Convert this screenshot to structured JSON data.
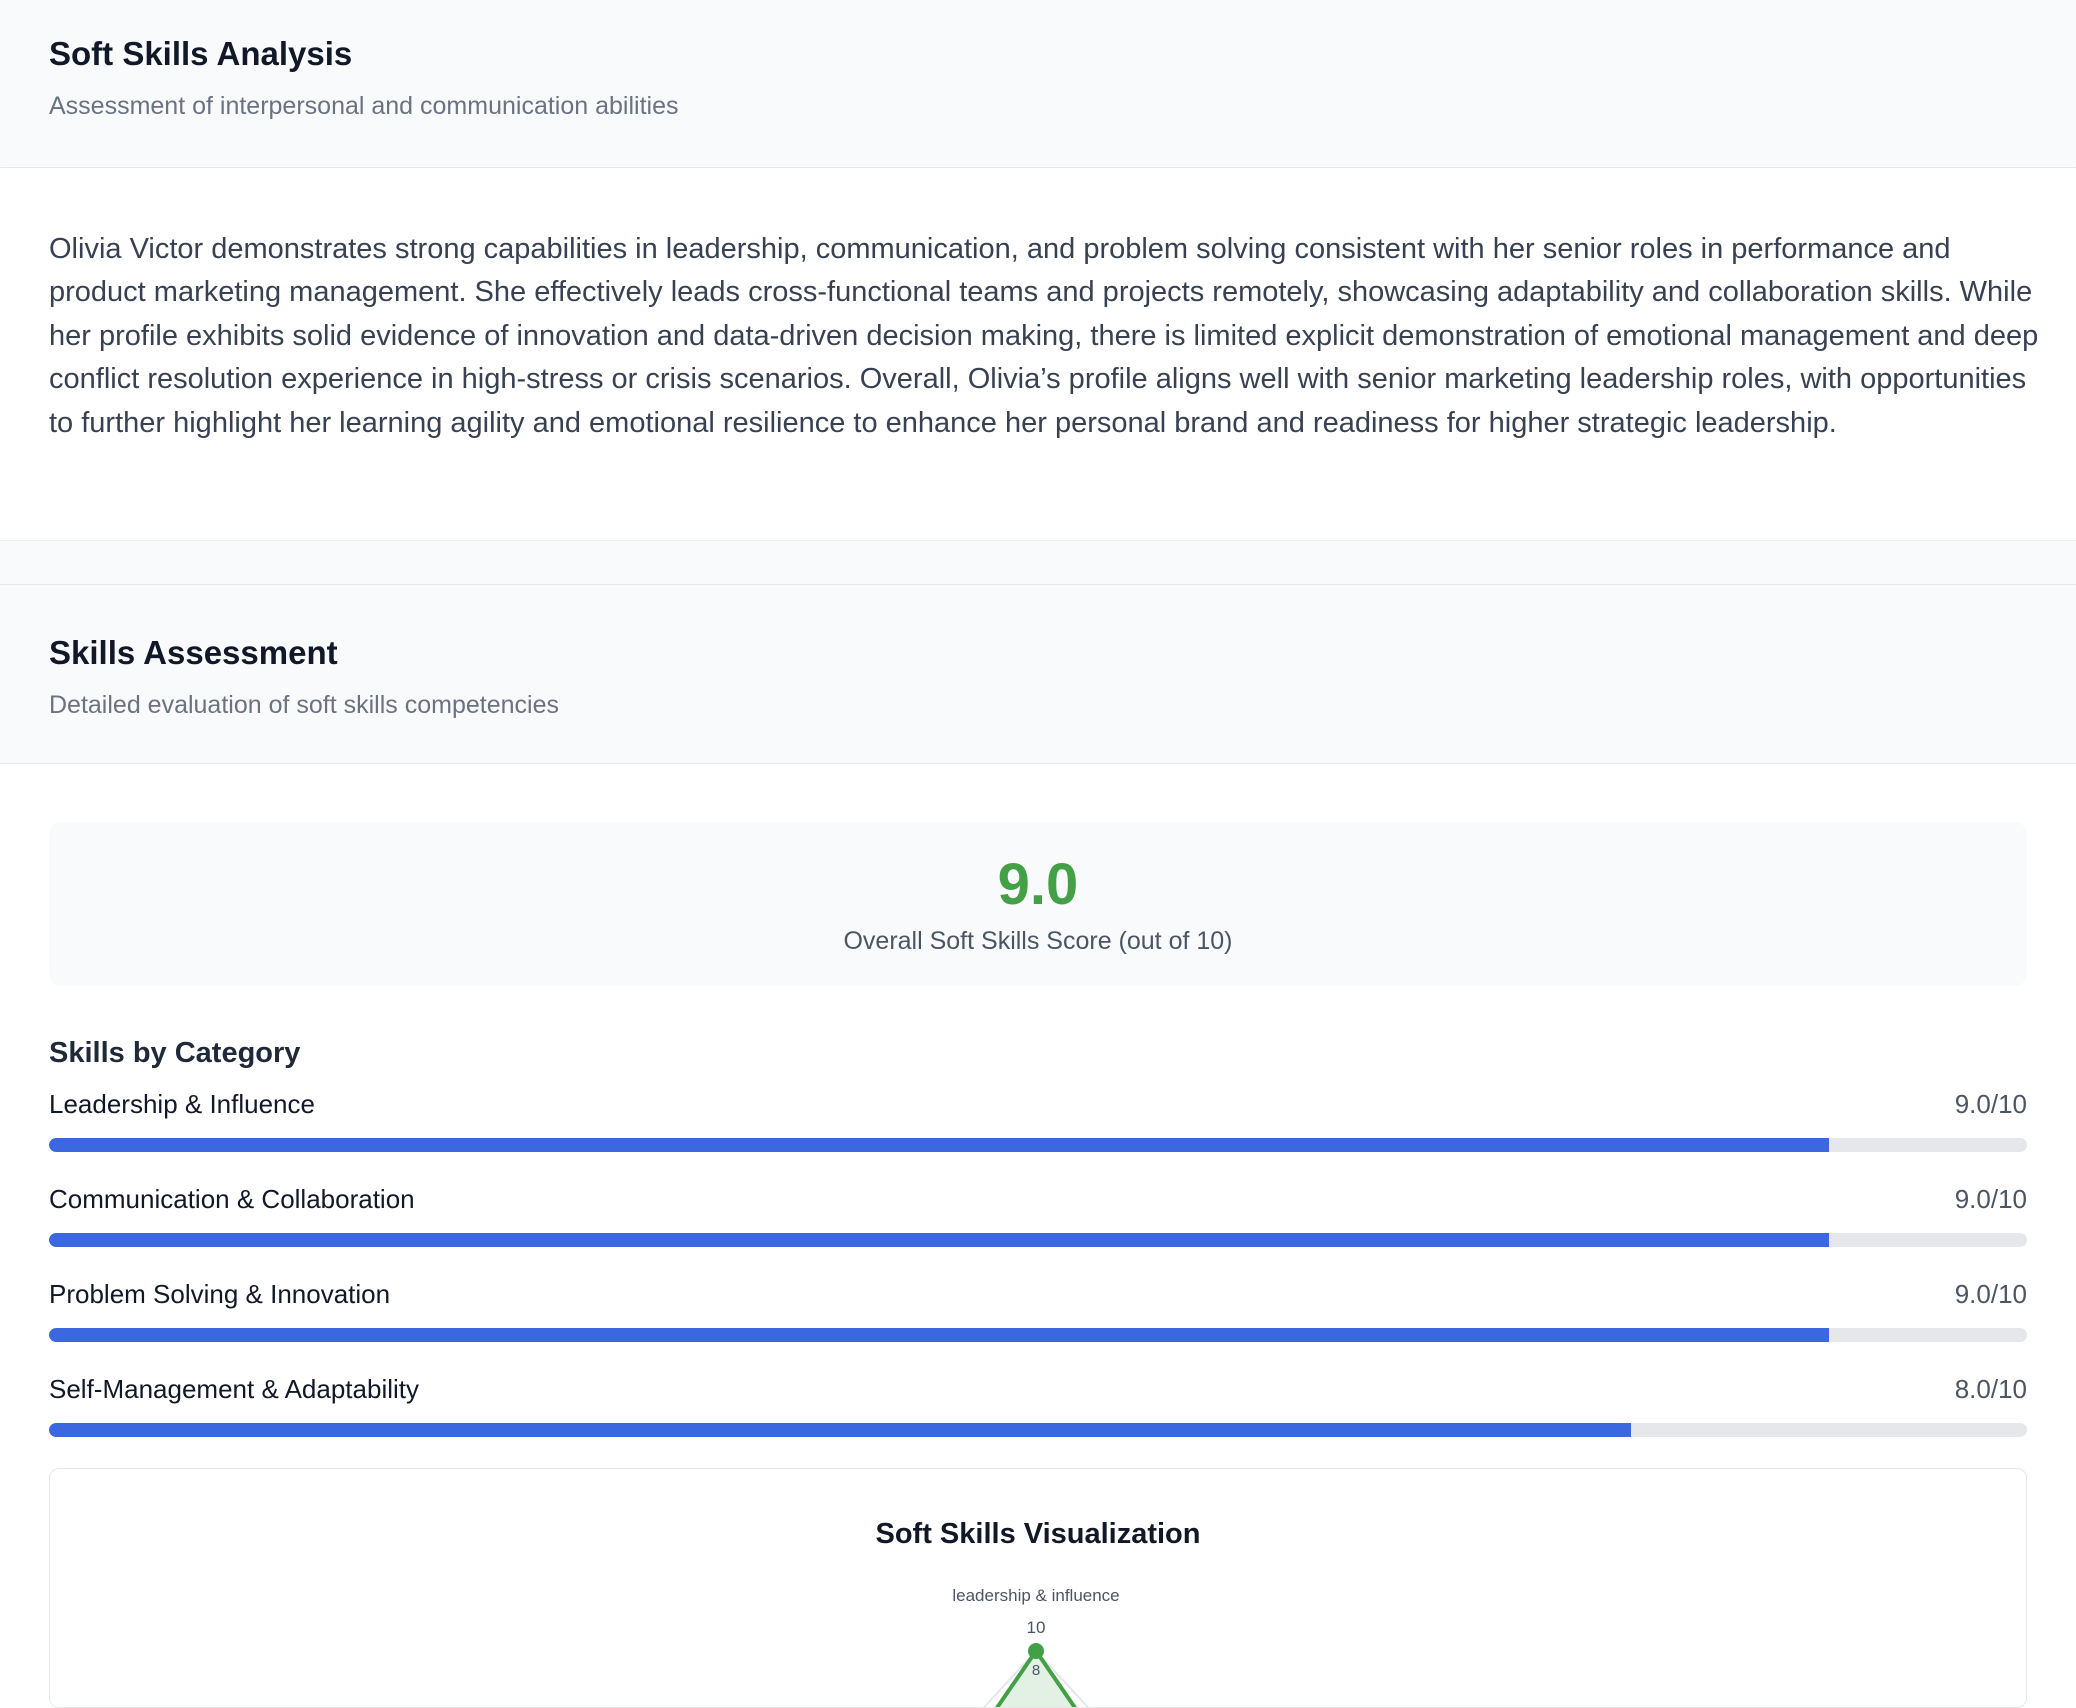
{
  "analysis": {
    "title": "Soft Skills Analysis",
    "subtitle": "Assessment of interpersonal and communication abilities",
    "summary": "Olivia Victor demonstrates strong capabilities in leadership, communication, and problem solving consistent with her senior roles in performance and product marketing management. She effectively leads cross-functional teams and projects remotely, showcasing adaptability and collaboration skills. While her profile exhibits solid evidence of innovation and data-driven decision making, there is limited explicit demonstration of emotional management and deep conflict resolution experience in high-stress or crisis scenarios. Overall, Olivia’s profile aligns well with senior marketing leadership roles, with opportunities to further highlight her learning agility and emotional resilience to enhance her personal brand and readiness for higher strategic leadership."
  },
  "assessment": {
    "title": "Skills Assessment",
    "subtitle": "Detailed evaluation of soft skills competencies",
    "overall_score": "9.0",
    "overall_label": "Overall Soft Skills Score (out of 10)",
    "category_title": "Skills by Category",
    "skills": [
      {
        "name": "Leadership & Influence",
        "score": "9.0/10",
        "value": 9.0
      },
      {
        "name": "Communication & Collaboration",
        "score": "9.0/10",
        "value": 9.0
      },
      {
        "name": "Problem Solving & Innovation",
        "score": "9.0/10",
        "value": 9.0
      },
      {
        "name": "Self-Management & Adaptability",
        "score": "8.0/10",
        "value": 8.0
      }
    ]
  },
  "visualization": {
    "title": "Soft Skills Visualization",
    "axis_top_label": "leadership & influence",
    "tick_10": "10",
    "tick_8": "8"
  },
  "colors": {
    "accent_green": "#43a047",
    "bar_blue": "#3b67e0",
    "track_gray": "#e5e7eb"
  }
}
